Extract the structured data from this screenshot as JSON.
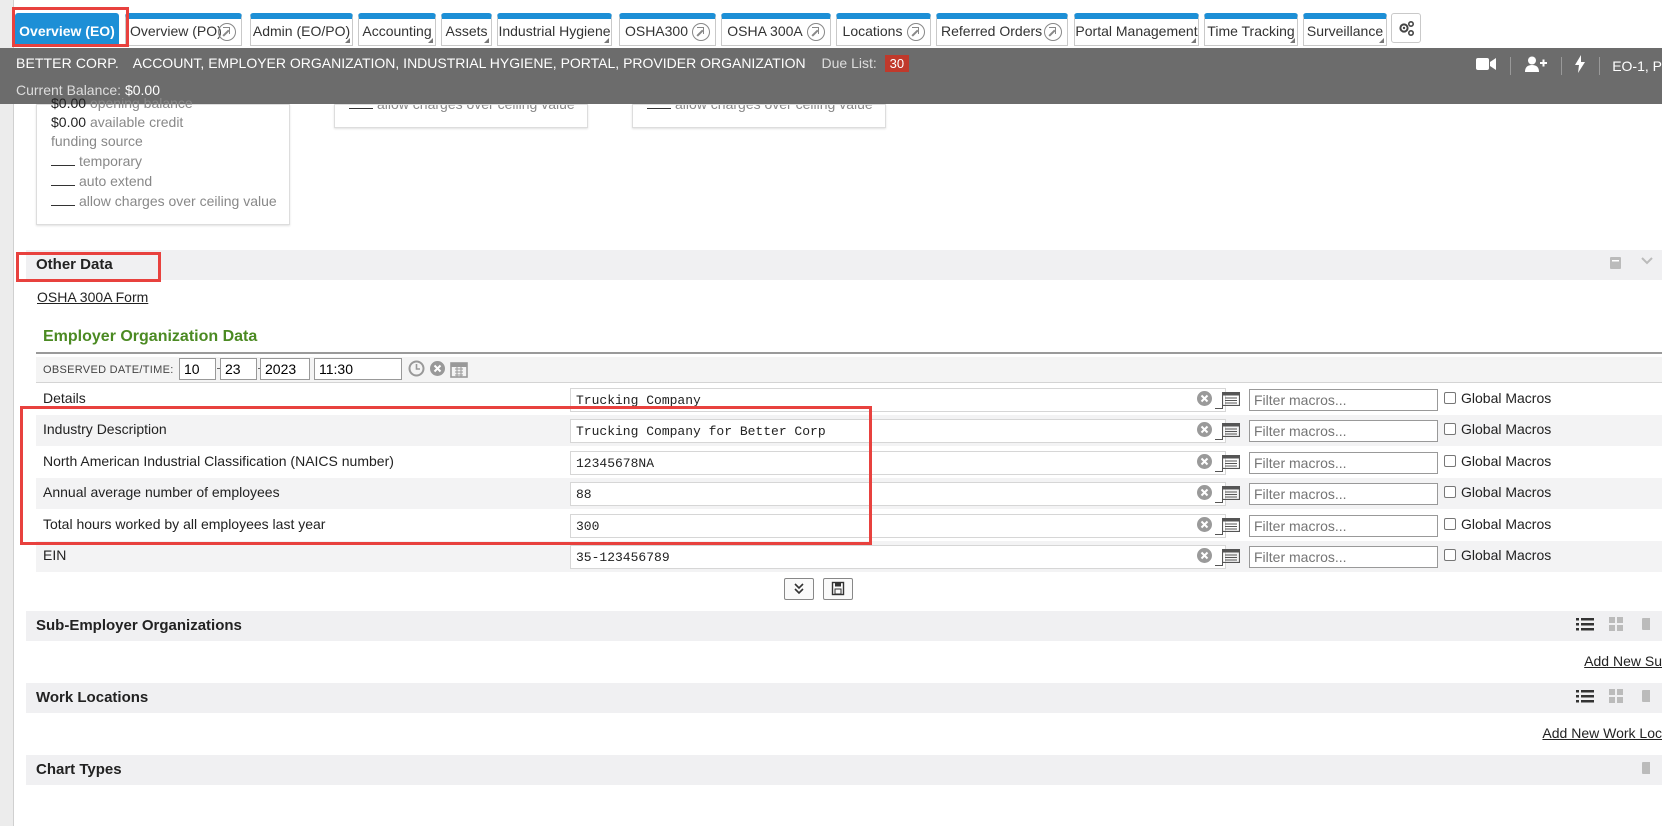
{
  "tabs": [
    {
      "label": "Overview (EO)",
      "active": true
    },
    {
      "label": "Overview (PO)",
      "external": true
    },
    {
      "label": "Admin (EO/PO)",
      "menu": true
    },
    {
      "label": "Accounting",
      "menu": true
    },
    {
      "label": "Assets",
      "menu": true
    },
    {
      "label": "Industrial Hygiene",
      "menu": true
    },
    {
      "label": "OSHA300",
      "external": true
    },
    {
      "label": "OSHA 300A",
      "external": true
    },
    {
      "label": "Locations",
      "external": true
    },
    {
      "label": "Referred Orders",
      "external": true
    },
    {
      "label": "Portal Management",
      "menu": true
    },
    {
      "label": "Time Tracking",
      "menu": true
    },
    {
      "label": "Surveillance",
      "menu": true
    }
  ],
  "header": {
    "org_name": "BETTER CORP.",
    "roles": "ACCOUNT, EMPLOYER ORGANIZATION, INDUSTRIAL HYGIENE, PORTAL, PROVIDER ORGANIZATION",
    "due_label": "Due List:",
    "due_count": "30",
    "balance_label": "Current Balance:",
    "balance_value": "$0.00",
    "right_text": "EO-1, P"
  },
  "funding": {
    "opening_value": "$0.00",
    "opening_label": "opening balance",
    "credit_value": "$0.00",
    "credit_label": "available credit",
    "source_label": "funding source",
    "temporary_label": "temporary",
    "auto_extend_label": "auto extend",
    "allow_charges_label": "allow charges over ceiling value"
  },
  "other_data": {
    "title": "Other Data",
    "osha_link": "OSHA 300A Form"
  },
  "eo_data": {
    "title": "Employer Organization Data",
    "observed_label": "OBSERVED DATE/TIME:",
    "month": "10",
    "day": "23",
    "year": "2023",
    "time": "11:30",
    "filter_placeholder": "Filter macros...",
    "global_macros_label": "Global Macros",
    "rows": [
      {
        "label": "Details",
        "value": "Trucking Company"
      },
      {
        "label": "Industry Description",
        "value": "Trucking Company for Better Corp"
      },
      {
        "label": "North American Industrial Classification (NAICS number)",
        "value": "12345678NA"
      },
      {
        "label": "Annual average number of employees",
        "value": "88"
      },
      {
        "label": "Total hours worked by all employees last year",
        "value": "300"
      },
      {
        "label": "EIN",
        "value": "35-123456789"
      }
    ]
  },
  "sections": {
    "sub_employer": {
      "title": "Sub-Employer Organizations",
      "link": "Add New Su"
    },
    "work_locations": {
      "title": "Work Locations",
      "link": "Add New Work Loc"
    },
    "chart_types": {
      "title": "Chart Types"
    }
  },
  "colors": {
    "tab_accent": "#1d8fd6",
    "header_bg": "#6c6c6c",
    "section_title_green": "#4b8a22",
    "badge_red": "#c0392b",
    "highlight_red": "#e8413e"
  }
}
